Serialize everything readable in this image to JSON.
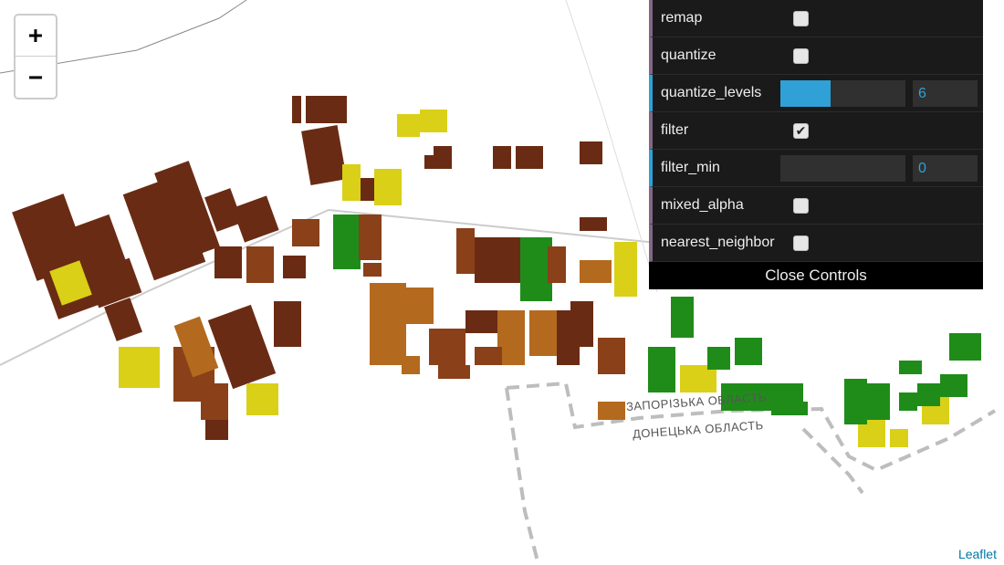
{
  "map": {
    "zoom_in_label": "+",
    "zoom_out_label": "−",
    "attribution": "Leaflet",
    "labels": [
      "ЗАПОРІЗЬКА ОБЛАСТЬ",
      "ДОНЕЦЬКА ОБЛАСТЬ"
    ],
    "colors": {
      "field_dark": "#6a2b14",
      "field_brown": "#8a4019",
      "field_orange": "#b36a1e",
      "field_yellow": "#d9d017",
      "field_green": "#1f8c1a",
      "road": "#cccccc",
      "border": "#bdbdbd"
    }
  },
  "controls": {
    "rows": [
      {
        "label": "remap",
        "type": "checkbox",
        "checked": false
      },
      {
        "label": "quantize",
        "type": "checkbox",
        "checked": false
      },
      {
        "label": "quantize_levels",
        "type": "number",
        "value": "6",
        "fill": 0.4
      },
      {
        "label": "filter",
        "type": "checkbox",
        "checked": true
      },
      {
        "label": "filter_min",
        "type": "number",
        "value": "0",
        "fill": 0
      },
      {
        "label": "mixed_alpha",
        "type": "checkbox",
        "checked": false
      },
      {
        "label": "nearest_neighbor",
        "type": "checkbox",
        "checked": false
      }
    ],
    "close_label": "Close Controls",
    "colors": {
      "accent": "#2fa1d6",
      "bool_border": "#806787",
      "background": "#1a1a1a"
    }
  }
}
